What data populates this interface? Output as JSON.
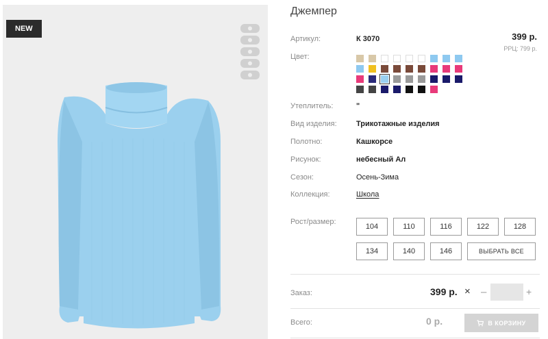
{
  "badge": {
    "new": "NEW"
  },
  "product": {
    "title": "Джемпер",
    "article_label": "Артикул:",
    "article_value": "К 3070",
    "price": "399 р.",
    "rrp": "РРЦ: 799 р.",
    "color_label": "Цвет:",
    "insulation_label": "Утеплитель:",
    "insulation_value": "\"",
    "type_label": "Вид изделия:",
    "type_value": "Трикотажные изделия",
    "fabric_label": "Полотно:",
    "fabric_value": "Кашкорсе",
    "pattern_label": "Рисунок:",
    "pattern_value": "небесный Ал",
    "season_label": "Сезон:",
    "season_value": "Осень-Зима",
    "collection_label": "Коллекция:",
    "collection_value": "Школа"
  },
  "swatches": [
    "#d8c8a8",
    "#d8c8a8",
    "#ffffff",
    "#ffffff",
    "#ffffff",
    "#ffffff",
    "#8ec9f0",
    "#8ec9f0",
    "#8ec9f0",
    "#8ec9f0",
    "#f0c020",
    "#7a4a3a",
    "#7a4a3a",
    "#7a4a3a",
    "#7a4a3a",
    "#e83a7a",
    "#e83a7a",
    "#e83a7a",
    "#e83a7a",
    "#2a2a7a",
    "#9ad0f0",
    "#9a9a9a",
    "#9a9a9a",
    "#9a9a9a",
    "#1a1a6a",
    "#1a1a6a",
    "#1a1a6a",
    "#444444",
    "#444444",
    "#1a1a6a",
    "#1a1a6a",
    "#111111",
    "#111111",
    "#e83a7a"
  ],
  "swatch_selected_index": 20,
  "sizes": {
    "label": "Рост/размер:",
    "options": [
      "104",
      "110",
      "116",
      "122",
      "128",
      "134",
      "140",
      "146"
    ],
    "select_all": "ВЫБРАТЬ ВСЕ"
  },
  "order": {
    "label": "Заказ:",
    "price": "399 р.",
    "multiply": "×",
    "minus": "–",
    "plus": "+",
    "qty": ""
  },
  "total": {
    "label": "Всего:",
    "value": "0 р.",
    "cart_button": "В КОРЗИНУ"
  },
  "icons": {
    "cart": "cart-icon",
    "logo": "acoola-logo"
  }
}
